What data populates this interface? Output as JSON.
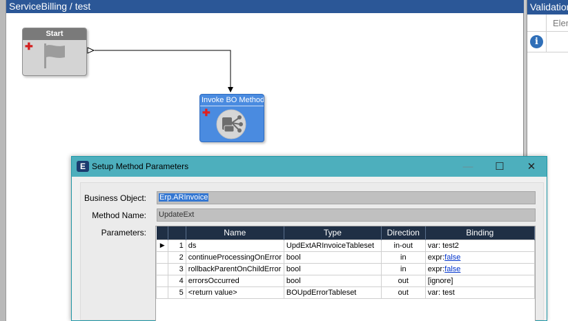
{
  "designer": {
    "title": "ServiceBilling / test"
  },
  "validation": {
    "title": "Validation",
    "column": "Element",
    "info_icon": "i"
  },
  "nodes": {
    "start": {
      "title": "Start",
      "icon": "flag-icon"
    },
    "invoke": {
      "title": "Invoke BO Method",
      "icon": "bo-method-icon"
    }
  },
  "dialog": {
    "title": "Setup Method Parameters",
    "app_icon": "E",
    "controls": {
      "minimize": "—",
      "maximize": "☐",
      "close": "✕"
    },
    "business_object_label": "Business Object:",
    "business_object_value": "Erp.ARInvoice",
    "method_name_label": "Method Name:",
    "method_name_value": "UpdateExt",
    "parameters_label": "Parameters:",
    "columns": [
      "Name",
      "Type",
      "Direction",
      "Binding"
    ],
    "rows": [
      {
        "num": "1",
        "name": "ds",
        "type": "UpdExtARInvoiceTableset",
        "direction": "in-out",
        "binding_prefix": "var: test2",
        "binding_link": ""
      },
      {
        "num": "2",
        "name": "continueProcessingOnError",
        "type": "bool",
        "direction": "in",
        "binding_prefix": "expr:",
        "binding_link": "false"
      },
      {
        "num": "3",
        "name": "rollbackParentOnChildError",
        "type": "bool",
        "direction": "in",
        "binding_prefix": "expr:",
        "binding_link": "false"
      },
      {
        "num": "4",
        "name": "errorsOccurred",
        "type": "bool",
        "direction": "out",
        "binding_prefix": "[ignore]",
        "binding_link": ""
      },
      {
        "num": "5",
        "name": "<return value>",
        "type": "BOUpdErrorTableset",
        "direction": "out",
        "binding_prefix": "var: test",
        "binding_link": ""
      }
    ],
    "current_row_marker": "▶"
  },
  "colors": {
    "header_blue": "#2b5797",
    "dialog_teal": "#4dafbd",
    "grid_header": "#1f2f45",
    "node_blue": "#4a8be0"
  }
}
